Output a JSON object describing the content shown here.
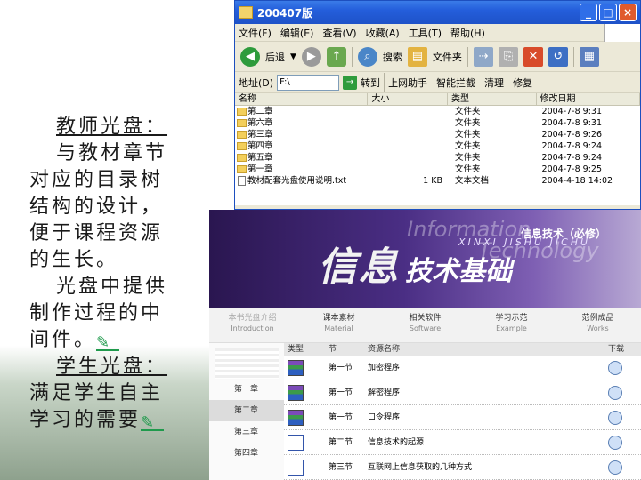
{
  "slide": {
    "lines": [
      {
        "text": "教师光盘：",
        "underline": true,
        "indent": true
      },
      {
        "text": "与教材章节",
        "indent": true
      },
      {
        "text": "对应的目录树"
      },
      {
        "text": "结构的设计，"
      },
      {
        "text": "便于课程资源"
      },
      {
        "text": "的生长。"
      },
      {
        "text": "光盘中提供",
        "indent": true
      },
      {
        "text": "制作过程的中"
      },
      {
        "text": "间件。",
        "note": true
      },
      {
        "text": "学生光盘：",
        "underline": true,
        "indent": true
      },
      {
        "text": "满足学生自主"
      },
      {
        "text": "学习的需要",
        "note": true
      }
    ],
    "note_icon": "notepad-icon"
  },
  "explorer": {
    "title": "200407版",
    "menu": [
      "文件(F)",
      "编辑(E)",
      "查看(V)",
      "收藏(A)",
      "工具(T)",
      "帮助(H)"
    ],
    "toolbar": {
      "back": "后退",
      "search": "搜索",
      "folders": "文件夹"
    },
    "address": {
      "label": "地址(D)",
      "value": "F:\\",
      "go": "转到"
    },
    "links": [
      "上网助手",
      "智能拦截",
      "清理",
      "修复"
    ],
    "columns": [
      "名称",
      "大小",
      "类型",
      "修改日期"
    ],
    "files": [
      {
        "name": "第二章",
        "size": "",
        "type": "文件夹",
        "date": "2004-7-8 9:31",
        "icon": "folder"
      },
      {
        "name": "第六章",
        "size": "",
        "type": "文件夹",
        "date": "2004-7-8 9:31",
        "icon": "folder"
      },
      {
        "name": "第三章",
        "size": "",
        "type": "文件夹",
        "date": "2004-7-8 9:26",
        "icon": "folder"
      },
      {
        "name": "第四章",
        "size": "",
        "type": "文件夹",
        "date": "2004-7-8 9:24",
        "icon": "folder"
      },
      {
        "name": "第五章",
        "size": "",
        "type": "文件夹",
        "date": "2004-7-8 9:24",
        "icon": "folder"
      },
      {
        "name": "第一章",
        "size": "",
        "type": "文件夹",
        "date": "2004-7-8 9:25",
        "icon": "folder"
      },
      {
        "name": "教材配套光盘使用说明.txt",
        "size": "1 KB",
        "type": "文本文档",
        "date": "2004-4-18 14:02",
        "icon": "text"
      }
    ]
  },
  "site": {
    "banner": {
      "info": "Information",
      "tech": "Technology",
      "subtitle": "信息技术（必修）",
      "big": "信息",
      "mid": "技术基础",
      "pinyin": "XINXI JISHU JICHU"
    },
    "nav": [
      {
        "cn": "本书光盘介绍",
        "en": "Introduction",
        "dim": true
      },
      {
        "cn": "课本素材",
        "en": "Material",
        "dim": false
      },
      {
        "cn": "相关软件",
        "en": "Software",
        "dim": false
      },
      {
        "cn": "学习示范",
        "en": "Example",
        "dim": false
      },
      {
        "cn": "范例成品",
        "en": "Works",
        "dim": false
      }
    ],
    "side": [
      "第一章",
      "第二章",
      "第三章",
      "第四章"
    ],
    "side_selected": 1,
    "table_head": [
      "类型",
      "节",
      "资源名称",
      "",
      "下载"
    ],
    "rows": [
      {
        "type_icon": "archive-icon",
        "section": "第一节",
        "name": "加密程序"
      },
      {
        "type_icon": "archive-icon",
        "section": "第一节",
        "name": "解密程序"
      },
      {
        "type_icon": "archive-icon",
        "section": "第一节",
        "name": "口令程序"
      },
      {
        "type_icon": "doc-icon",
        "section": "第二节",
        "name": "信息技术的起源"
      },
      {
        "type_icon": "doc-icon",
        "section": "第三节",
        "name": "互联网上信息获取的几种方式"
      }
    ]
  },
  "colors": {
    "titlebar": "#245edb",
    "banner": "#4a2e84",
    "note": "#1f9a4c"
  }
}
